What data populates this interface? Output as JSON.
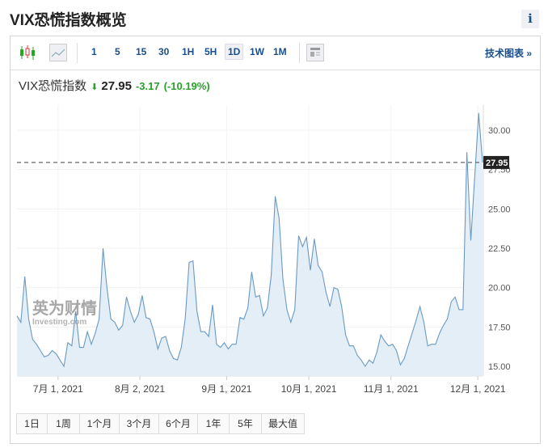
{
  "title": "VIX恐慌指数概览",
  "info_label": "i",
  "toolbar": {
    "intervals": [
      "1",
      "5",
      "15",
      "30",
      "1H",
      "5H",
      "1D",
      "1W",
      "1M"
    ],
    "selected": "1D",
    "tech_chart": "技术图表 »"
  },
  "quote": {
    "name": "VIX恐慌指数",
    "price": "27.95",
    "change": "-3.17",
    "change_pct": "(-10.19%)",
    "direction": "down"
  },
  "watermark": {
    "cn": "英为财情",
    "en": "Investing.com"
  },
  "ranges": [
    "1日",
    "1周",
    "1个月",
    "3个月",
    "6个月",
    "1年",
    "5年",
    "最大值"
  ],
  "chart_data": {
    "type": "area",
    "ylim": [
      14.4,
      32.5
    ],
    "yticks": [
      15,
      17.5,
      20,
      22.5,
      25,
      27.5,
      30
    ],
    "ytick_labels": [
      "15.00",
      "17.50",
      "20.00",
      "22.50",
      "25.00",
      "27.50",
      "30.00"
    ],
    "xticks": [
      10.5,
      31.4,
      53.6,
      74.6,
      95.6,
      117.8
    ],
    "xtick_labels": [
      "7月 1, 2021",
      "8月 2, 2021",
      "9月 1, 2021",
      "10月 1, 2021",
      "11月 1, 2021",
      "12月 1, 2021"
    ],
    "current": 27.95,
    "current_label": "27.95",
    "color": "#6a9ac4",
    "values": [
      18.2,
      17.8,
      20.7,
      18.0,
      16.7,
      16.4,
      16.0,
      15.6,
      15.7,
      16.0,
      15.8,
      15.4,
      15.0,
      16.5,
      16.3,
      18.5,
      16.2,
      16.2,
      17.2,
      16.4,
      17.1,
      18.0,
      22.5,
      20.0,
      18.0,
      17.8,
      17.3,
      17.6,
      19.4,
      18.5,
      17.8,
      18.3,
      19.5,
      18.1,
      18.0,
      17.2,
      16.1,
      16.8,
      16.9,
      16.0,
      15.5,
      15.4,
      16.2,
      18.0,
      21.6,
      21.7,
      18.5,
      17.2,
      17.2,
      16.9,
      18.9,
      16.4,
      16.2,
      16.5,
      16.1,
      16.4,
      16.4,
      18.1,
      18.0,
      18.7,
      21.0,
      19.4,
      19.5,
      18.2,
      18.7,
      20.8,
      25.8,
      24.4,
      20.5,
      18.6,
      17.8,
      18.6,
      23.3,
      22.6,
      23.2,
      21.1,
      23.1,
      21.4,
      21.0,
      19.7,
      18.8,
      20.0,
      19.9,
      18.8,
      17.0,
      16.3,
      16.3,
      15.7,
      15.4,
      15.0,
      15.4,
      15.2,
      15.9,
      17.0,
      16.6,
      16.3,
      16.4,
      16.0,
      15.1,
      15.5,
      16.3,
      17.1,
      17.9,
      18.8,
      17.8,
      16.3,
      16.4,
      16.4,
      17.1,
      17.6,
      18.0,
      19.1,
      19.4,
      18.6,
      18.6,
      28.6,
      23.0,
      27.0,
      31.1,
      27.95
    ]
  }
}
